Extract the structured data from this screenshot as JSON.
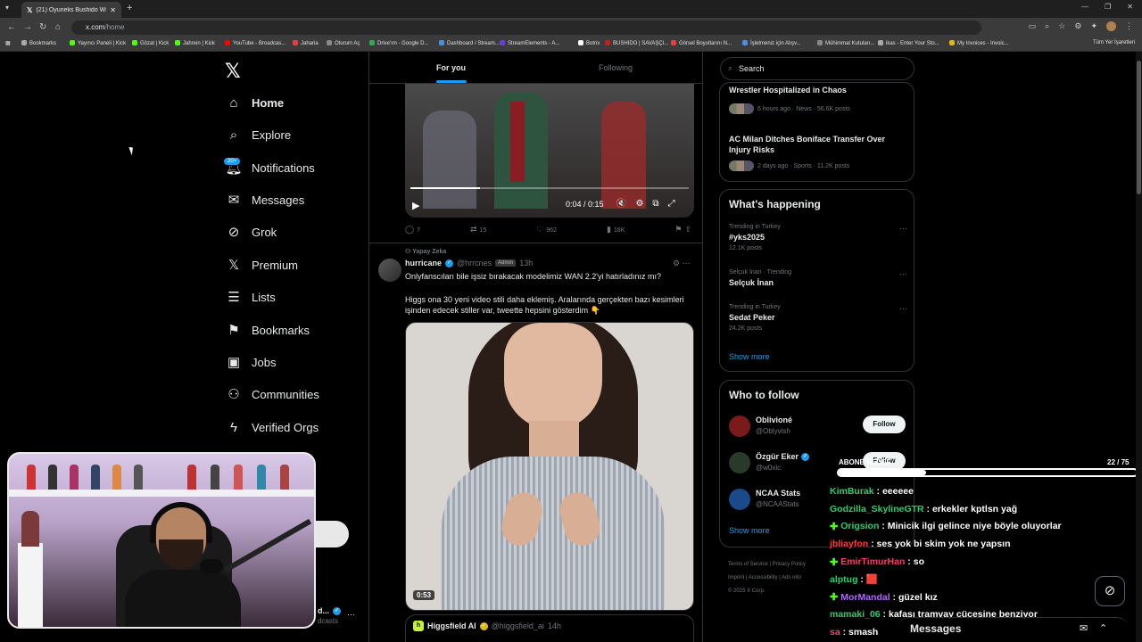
{
  "browser": {
    "tab_title": "(21) Oyuneks Bushido Wildcats",
    "url_host": "x.com",
    "url_path": "/home",
    "bookmarks": [
      {
        "label": "Bookmarks",
        "color": "#aaaaaa"
      },
      {
        "label": "Yayıncı Paneli | Kick",
        "color": "#53fc18"
      },
      {
        "label": "Gözat | Kick",
        "color": "#53fc18"
      },
      {
        "label": "Jahrein | Kick",
        "color": "#53fc18"
      },
      {
        "label": "YouTube - Broadcas...",
        "color": "#ff0000"
      },
      {
        "label": "Jaharia",
        "color": "#e04040"
      },
      {
        "label": "Oturum Aç",
        "color": "#888888"
      },
      {
        "label": "Drive'ım - Google D...",
        "color": "#34a853"
      },
      {
        "label": "Dashboard / Stream...",
        "color": "#4a90e2"
      },
      {
        "label": "StreamElements - A...",
        "color": "#6a3fd8"
      },
      {
        "label": "Botrix",
        "color": "#ffffff"
      },
      {
        "label": "BUSHIDO | SAVAŞÇI...",
        "color": "#c02020"
      },
      {
        "label": "Görsel Boyutlarını N...",
        "color": "#e04040"
      },
      {
        "label": "İşletmeniz için Alışv...",
        "color": "#4a90e2"
      },
      {
        "label": "Mühimmat Kutuları...",
        "color": "#888888"
      },
      {
        "label": "ikas - Enter Your Sto...",
        "color": "#aaaaaa"
      },
      {
        "label": "My Invoices - Invoic...",
        "color": "#e2b719"
      }
    ],
    "all_bookmarks": "Tüm Yer İşaretleri"
  },
  "nav": {
    "items": [
      {
        "label": "Home",
        "icon": "home-icon"
      },
      {
        "label": "Explore",
        "icon": "search-icon"
      },
      {
        "label": "Notifications",
        "icon": "bell-icon"
      },
      {
        "label": "Messages",
        "icon": "envelope-icon"
      },
      {
        "label": "Grok",
        "icon": "grok-icon"
      },
      {
        "label": "Premium",
        "icon": "x-icon"
      },
      {
        "label": "Lists",
        "icon": "list-icon"
      },
      {
        "label": "Bookmarks",
        "icon": "bookmark-icon"
      },
      {
        "label": "Jobs",
        "icon": "briefcase-icon"
      },
      {
        "label": "Communities",
        "icon": "people-icon"
      },
      {
        "label": "Verified Orgs",
        "icon": "lightning-icon"
      }
    ],
    "notif_badge": "20+"
  },
  "timeline": {
    "tabs": {
      "foryou": "For you",
      "following": "Following"
    },
    "video1": {
      "time": "0:04 / 0:15",
      "progress": 0.25,
      "actions": {
        "replies": "7",
        "reposts": "15",
        "likes": "962",
        "views": "18K"
      }
    },
    "post": {
      "social_context": "Yapay Zeka",
      "name": "hurricane",
      "handle": "@hrrcnes",
      "badge": "Admin",
      "time": "13h",
      "text1": "Onlyfanscıları bile işsiz bırakacak modelimiz WAN 2.2'yi hatırladınız mı?",
      "text2": "Higgs ona 30 yeni video stili daha eklemiş. Aralarında gerçekten bazı kesimleri işinden edecek stiller var, tweette hepsini gösterdim 👇",
      "duration": "0:53",
      "quote": {
        "name": "Higgsfield AI",
        "handle": "@higgsfield_ai",
        "time": "14h"
      }
    }
  },
  "sidebar": {
    "search_placeholder": "Search",
    "news_partial": "Wrestler Hospitalized in Chaos",
    "news1_meta": "6 hours ago · News · 56.6K posts",
    "news2_title": "AC Milan Ditches Boniface Transfer Over Injury Risks",
    "news2_meta": "2 days ago · Sports · 11.2K posts",
    "whats_happening": "What's happening",
    "trends": [
      {
        "context": "Trending in Turkey",
        "name": "#yks2025",
        "posts": "12.1K posts"
      },
      {
        "context": "Selçuk İnan · Trending",
        "name": "Selçuk İnan",
        "posts": ""
      },
      {
        "context": "Trending in Turkey",
        "name": "Sedat Peker",
        "posts": "24.2K posts"
      }
    ],
    "show_more": "Show more",
    "who_to_follow": "Who to follow",
    "follow_suggestions": [
      {
        "name": "Oblivioné",
        "handle": "@Oblyvish",
        "verified": false,
        "avatar": "#7a1a1a"
      },
      {
        "name": "Özgür Eker",
        "handle": "@w0xic",
        "verified": true,
        "avatar": "#2a3a2a"
      },
      {
        "name": "NCAA Stats",
        "handle": "@NCAAStats",
        "verified": false,
        "avatar": "#1a4a8a"
      }
    ],
    "follow_label": "Follow",
    "footer": {
      "line1": "Terms of Service  |  Privacy Policy",
      "line2": "Imprint  |  Accessibility  |  Ads info",
      "line3": "© 2025 X Corp."
    }
  },
  "stream": {
    "profile_name": "d...",
    "profile_sub": "dcasts",
    "goal_label": "ABONE HEDEF",
    "goal_count": "22  / 75",
    "goal_value": 22,
    "goal_max": 75,
    "chat": [
      {
        "user": "KimBurak",
        "color": "#2ecc71",
        "badge": false,
        "msg": "eeeeee"
      },
      {
        "user": "Godzilla_SkylineGTR",
        "color": "#2ecc71",
        "badge": false,
        "msg": "erkekler kptlsn yağ"
      },
      {
        "user": "Origsion",
        "color": "#2ecc71",
        "badge": true,
        "msg": "Minicik ilgi gelince niye böyle oluyorlar"
      },
      {
        "user": "jbliayfon",
        "color": "#ff3b3b",
        "badge": false,
        "msg": "ses yok bi skim yok ne yapsın"
      },
      {
        "user": "EmirTimurHan",
        "color": "#ff3b6b",
        "badge": true,
        "msg": "so"
      },
      {
        "user": "alptug",
        "color": "#2ecc71",
        "badge": false,
        "msg": "🟥"
      },
      {
        "user": "MorMandal",
        "color": "#b066ff",
        "badge": true,
        "msg": "güzel kız"
      },
      {
        "user": "mamaki_06",
        "color": "#2ecc71",
        "badge": false,
        "msg": "kafası tramvay cücesine benziyor"
      },
      {
        "user": "sa",
        "color": "#ff3b6b",
        "badge": false,
        "msg": "smash"
      }
    ]
  },
  "messages_drawer": {
    "label": "Messages"
  }
}
